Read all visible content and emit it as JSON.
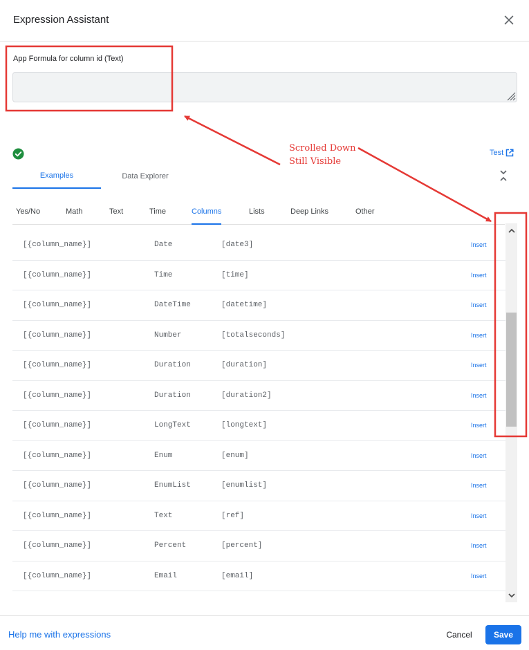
{
  "dialog": {
    "title": "Expression Assistant",
    "close_icon": "close-icon"
  },
  "formula": {
    "label": "App Formula for column id (Text)",
    "value": "",
    "placeholder": ""
  },
  "status": {
    "valid_icon": "check-circle-icon",
    "valid_color": "#1e8e3e"
  },
  "test": {
    "label": "Test",
    "icon": "open-in-new-icon"
  },
  "main_tabs": [
    {
      "label": "Examples",
      "active": true
    },
    {
      "label": "Data Explorer",
      "active": false
    }
  ],
  "collapse_icon": "collapse-icon",
  "category_tabs": [
    {
      "label": "Yes/No"
    },
    {
      "label": "Math"
    },
    {
      "label": "Text"
    },
    {
      "label": "Time"
    },
    {
      "label": "Columns",
      "active": true
    },
    {
      "label": "Lists"
    },
    {
      "label": "Deep Links"
    },
    {
      "label": "Other"
    }
  ],
  "rows": [
    {
      "syntax": "[{column_name}]",
      "type": "Date",
      "expr": "[date3]",
      "insert": "Insert"
    },
    {
      "syntax": "[{column_name}]",
      "type": "Time",
      "expr": "[time]",
      "insert": "Insert"
    },
    {
      "syntax": "[{column_name}]",
      "type": "DateTime",
      "expr": "[datetime]",
      "insert": "Insert"
    },
    {
      "syntax": "[{column_name}]",
      "type": "Number",
      "expr": "[totalseconds]",
      "insert": "Insert"
    },
    {
      "syntax": "[{column_name}]",
      "type": "Duration",
      "expr": "[duration]",
      "insert": "Insert"
    },
    {
      "syntax": "[{column_name}]",
      "type": "Duration",
      "expr": "[duration2]",
      "insert": "Insert"
    },
    {
      "syntax": "[{column_name}]",
      "type": "LongText",
      "expr": "[longtext]",
      "insert": "Insert"
    },
    {
      "syntax": "[{column_name}]",
      "type": "Enum",
      "expr": "[enum]",
      "insert": "Insert"
    },
    {
      "syntax": "[{column_name}]",
      "type": "EnumList",
      "expr": "[enumlist]",
      "insert": "Insert"
    },
    {
      "syntax": "[{column_name}]",
      "type": "Text",
      "expr": "[ref]",
      "insert": "Insert"
    },
    {
      "syntax": "[{column_name}]",
      "type": "Percent",
      "expr": "[percent]",
      "insert": "Insert"
    },
    {
      "syntax": "[{column_name}]",
      "type": "Email",
      "expr": "[email]",
      "insert": "Insert"
    }
  ],
  "footer": {
    "help_label": "Help me with expressions",
    "cancel_label": "Cancel",
    "save_label": "Save"
  },
  "annotation": {
    "line1": "Scrolled Down",
    "line2": "Still Visible",
    "color": "#e53935"
  },
  "colors": {
    "accent": "#1a73e8",
    "annotation": "#e53935"
  }
}
